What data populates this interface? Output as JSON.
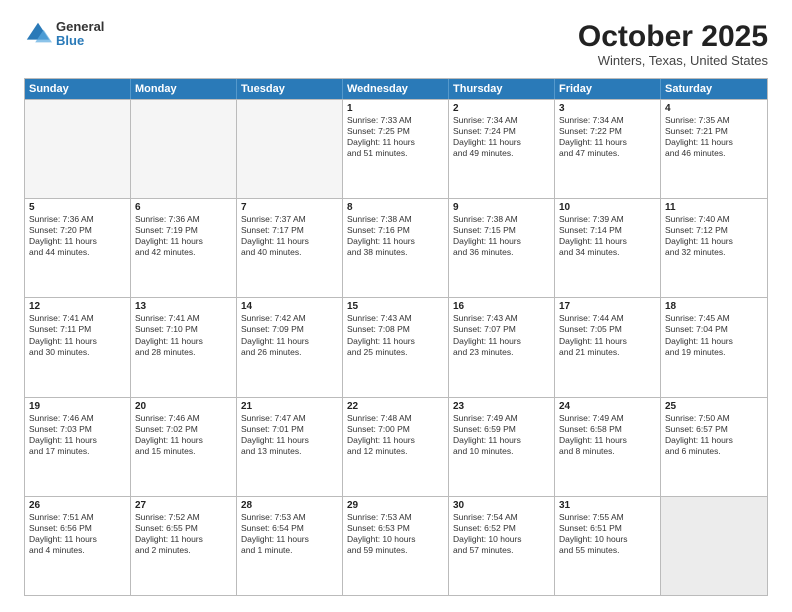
{
  "logo": {
    "general": "General",
    "blue": "Blue"
  },
  "title": "October 2025",
  "location": "Winters, Texas, United States",
  "days": [
    "Sunday",
    "Monday",
    "Tuesday",
    "Wednesday",
    "Thursday",
    "Friday",
    "Saturday"
  ],
  "weeks": [
    [
      {
        "day": "",
        "content": ""
      },
      {
        "day": "",
        "content": ""
      },
      {
        "day": "",
        "content": ""
      },
      {
        "day": "1",
        "content": "Sunrise: 7:33 AM\nSunset: 7:25 PM\nDaylight: 11 hours\nand 51 minutes."
      },
      {
        "day": "2",
        "content": "Sunrise: 7:34 AM\nSunset: 7:24 PM\nDaylight: 11 hours\nand 49 minutes."
      },
      {
        "day": "3",
        "content": "Sunrise: 7:34 AM\nSunset: 7:22 PM\nDaylight: 11 hours\nand 47 minutes."
      },
      {
        "day": "4",
        "content": "Sunrise: 7:35 AM\nSunset: 7:21 PM\nDaylight: 11 hours\nand 46 minutes."
      }
    ],
    [
      {
        "day": "5",
        "content": "Sunrise: 7:36 AM\nSunset: 7:20 PM\nDaylight: 11 hours\nand 44 minutes."
      },
      {
        "day": "6",
        "content": "Sunrise: 7:36 AM\nSunset: 7:19 PM\nDaylight: 11 hours\nand 42 minutes."
      },
      {
        "day": "7",
        "content": "Sunrise: 7:37 AM\nSunset: 7:17 PM\nDaylight: 11 hours\nand 40 minutes."
      },
      {
        "day": "8",
        "content": "Sunrise: 7:38 AM\nSunset: 7:16 PM\nDaylight: 11 hours\nand 38 minutes."
      },
      {
        "day": "9",
        "content": "Sunrise: 7:38 AM\nSunset: 7:15 PM\nDaylight: 11 hours\nand 36 minutes."
      },
      {
        "day": "10",
        "content": "Sunrise: 7:39 AM\nSunset: 7:14 PM\nDaylight: 11 hours\nand 34 minutes."
      },
      {
        "day": "11",
        "content": "Sunrise: 7:40 AM\nSunset: 7:12 PM\nDaylight: 11 hours\nand 32 minutes."
      }
    ],
    [
      {
        "day": "12",
        "content": "Sunrise: 7:41 AM\nSunset: 7:11 PM\nDaylight: 11 hours\nand 30 minutes."
      },
      {
        "day": "13",
        "content": "Sunrise: 7:41 AM\nSunset: 7:10 PM\nDaylight: 11 hours\nand 28 minutes."
      },
      {
        "day": "14",
        "content": "Sunrise: 7:42 AM\nSunset: 7:09 PM\nDaylight: 11 hours\nand 26 minutes."
      },
      {
        "day": "15",
        "content": "Sunrise: 7:43 AM\nSunset: 7:08 PM\nDaylight: 11 hours\nand 25 minutes."
      },
      {
        "day": "16",
        "content": "Sunrise: 7:43 AM\nSunset: 7:07 PM\nDaylight: 11 hours\nand 23 minutes."
      },
      {
        "day": "17",
        "content": "Sunrise: 7:44 AM\nSunset: 7:05 PM\nDaylight: 11 hours\nand 21 minutes."
      },
      {
        "day": "18",
        "content": "Sunrise: 7:45 AM\nSunset: 7:04 PM\nDaylight: 11 hours\nand 19 minutes."
      }
    ],
    [
      {
        "day": "19",
        "content": "Sunrise: 7:46 AM\nSunset: 7:03 PM\nDaylight: 11 hours\nand 17 minutes."
      },
      {
        "day": "20",
        "content": "Sunrise: 7:46 AM\nSunset: 7:02 PM\nDaylight: 11 hours\nand 15 minutes."
      },
      {
        "day": "21",
        "content": "Sunrise: 7:47 AM\nSunset: 7:01 PM\nDaylight: 11 hours\nand 13 minutes."
      },
      {
        "day": "22",
        "content": "Sunrise: 7:48 AM\nSunset: 7:00 PM\nDaylight: 11 hours\nand 12 minutes."
      },
      {
        "day": "23",
        "content": "Sunrise: 7:49 AM\nSunset: 6:59 PM\nDaylight: 11 hours\nand 10 minutes."
      },
      {
        "day": "24",
        "content": "Sunrise: 7:49 AM\nSunset: 6:58 PM\nDaylight: 11 hours\nand 8 minutes."
      },
      {
        "day": "25",
        "content": "Sunrise: 7:50 AM\nSunset: 6:57 PM\nDaylight: 11 hours\nand 6 minutes."
      }
    ],
    [
      {
        "day": "26",
        "content": "Sunrise: 7:51 AM\nSunset: 6:56 PM\nDaylight: 11 hours\nand 4 minutes."
      },
      {
        "day": "27",
        "content": "Sunrise: 7:52 AM\nSunset: 6:55 PM\nDaylight: 11 hours\nand 2 minutes."
      },
      {
        "day": "28",
        "content": "Sunrise: 7:53 AM\nSunset: 6:54 PM\nDaylight: 11 hours\nand 1 minute."
      },
      {
        "day": "29",
        "content": "Sunrise: 7:53 AM\nSunset: 6:53 PM\nDaylight: 10 hours\nand 59 minutes."
      },
      {
        "day": "30",
        "content": "Sunrise: 7:54 AM\nSunset: 6:52 PM\nDaylight: 10 hours\nand 57 minutes."
      },
      {
        "day": "31",
        "content": "Sunrise: 7:55 AM\nSunset: 6:51 PM\nDaylight: 10 hours\nand 55 minutes."
      },
      {
        "day": "",
        "content": ""
      }
    ]
  ]
}
